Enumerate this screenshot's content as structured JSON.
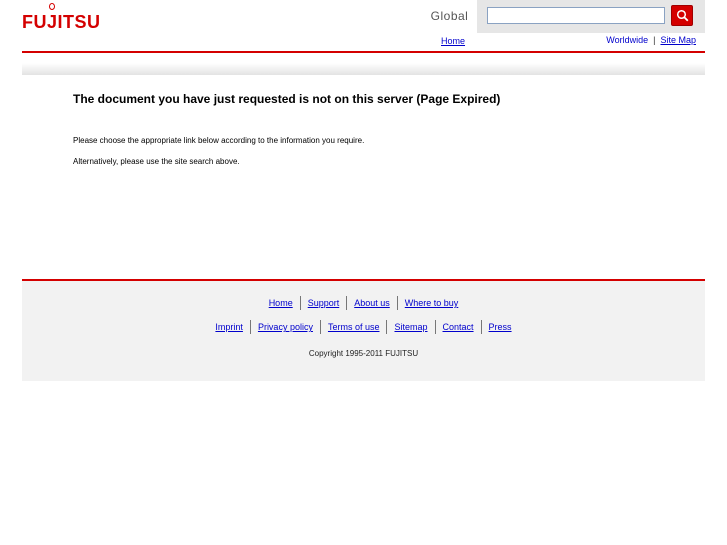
{
  "header": {
    "logo": {
      "pre": "FU",
      "i": "J",
      "post": "ITSU"
    },
    "global_label": "Global",
    "search": {
      "value": "",
      "placeholder": ""
    },
    "nav": {
      "home": "Home",
      "worldwide": "Worldwide",
      "separator": "|",
      "site_map": "Site Map"
    }
  },
  "main": {
    "title": "The document you have just requested is not on this server (Page Expired)",
    "line1": "Please choose the appropriate link below according to the information you require.",
    "line2": "Alternatively, please use the site search above."
  },
  "footer": {
    "row1": [
      "Home",
      "Support",
      "About us",
      "Where to buy"
    ],
    "row2": [
      "Imprint",
      "Privacy policy",
      "Terms of use",
      "Sitemap",
      "Contact",
      "Press"
    ],
    "copyright": "Copyright 1995-2011 FUJITSU"
  },
  "colors": {
    "brand_red": "#d40000",
    "link": "#0000cc",
    "footer_bg": "#f2f2f2"
  }
}
